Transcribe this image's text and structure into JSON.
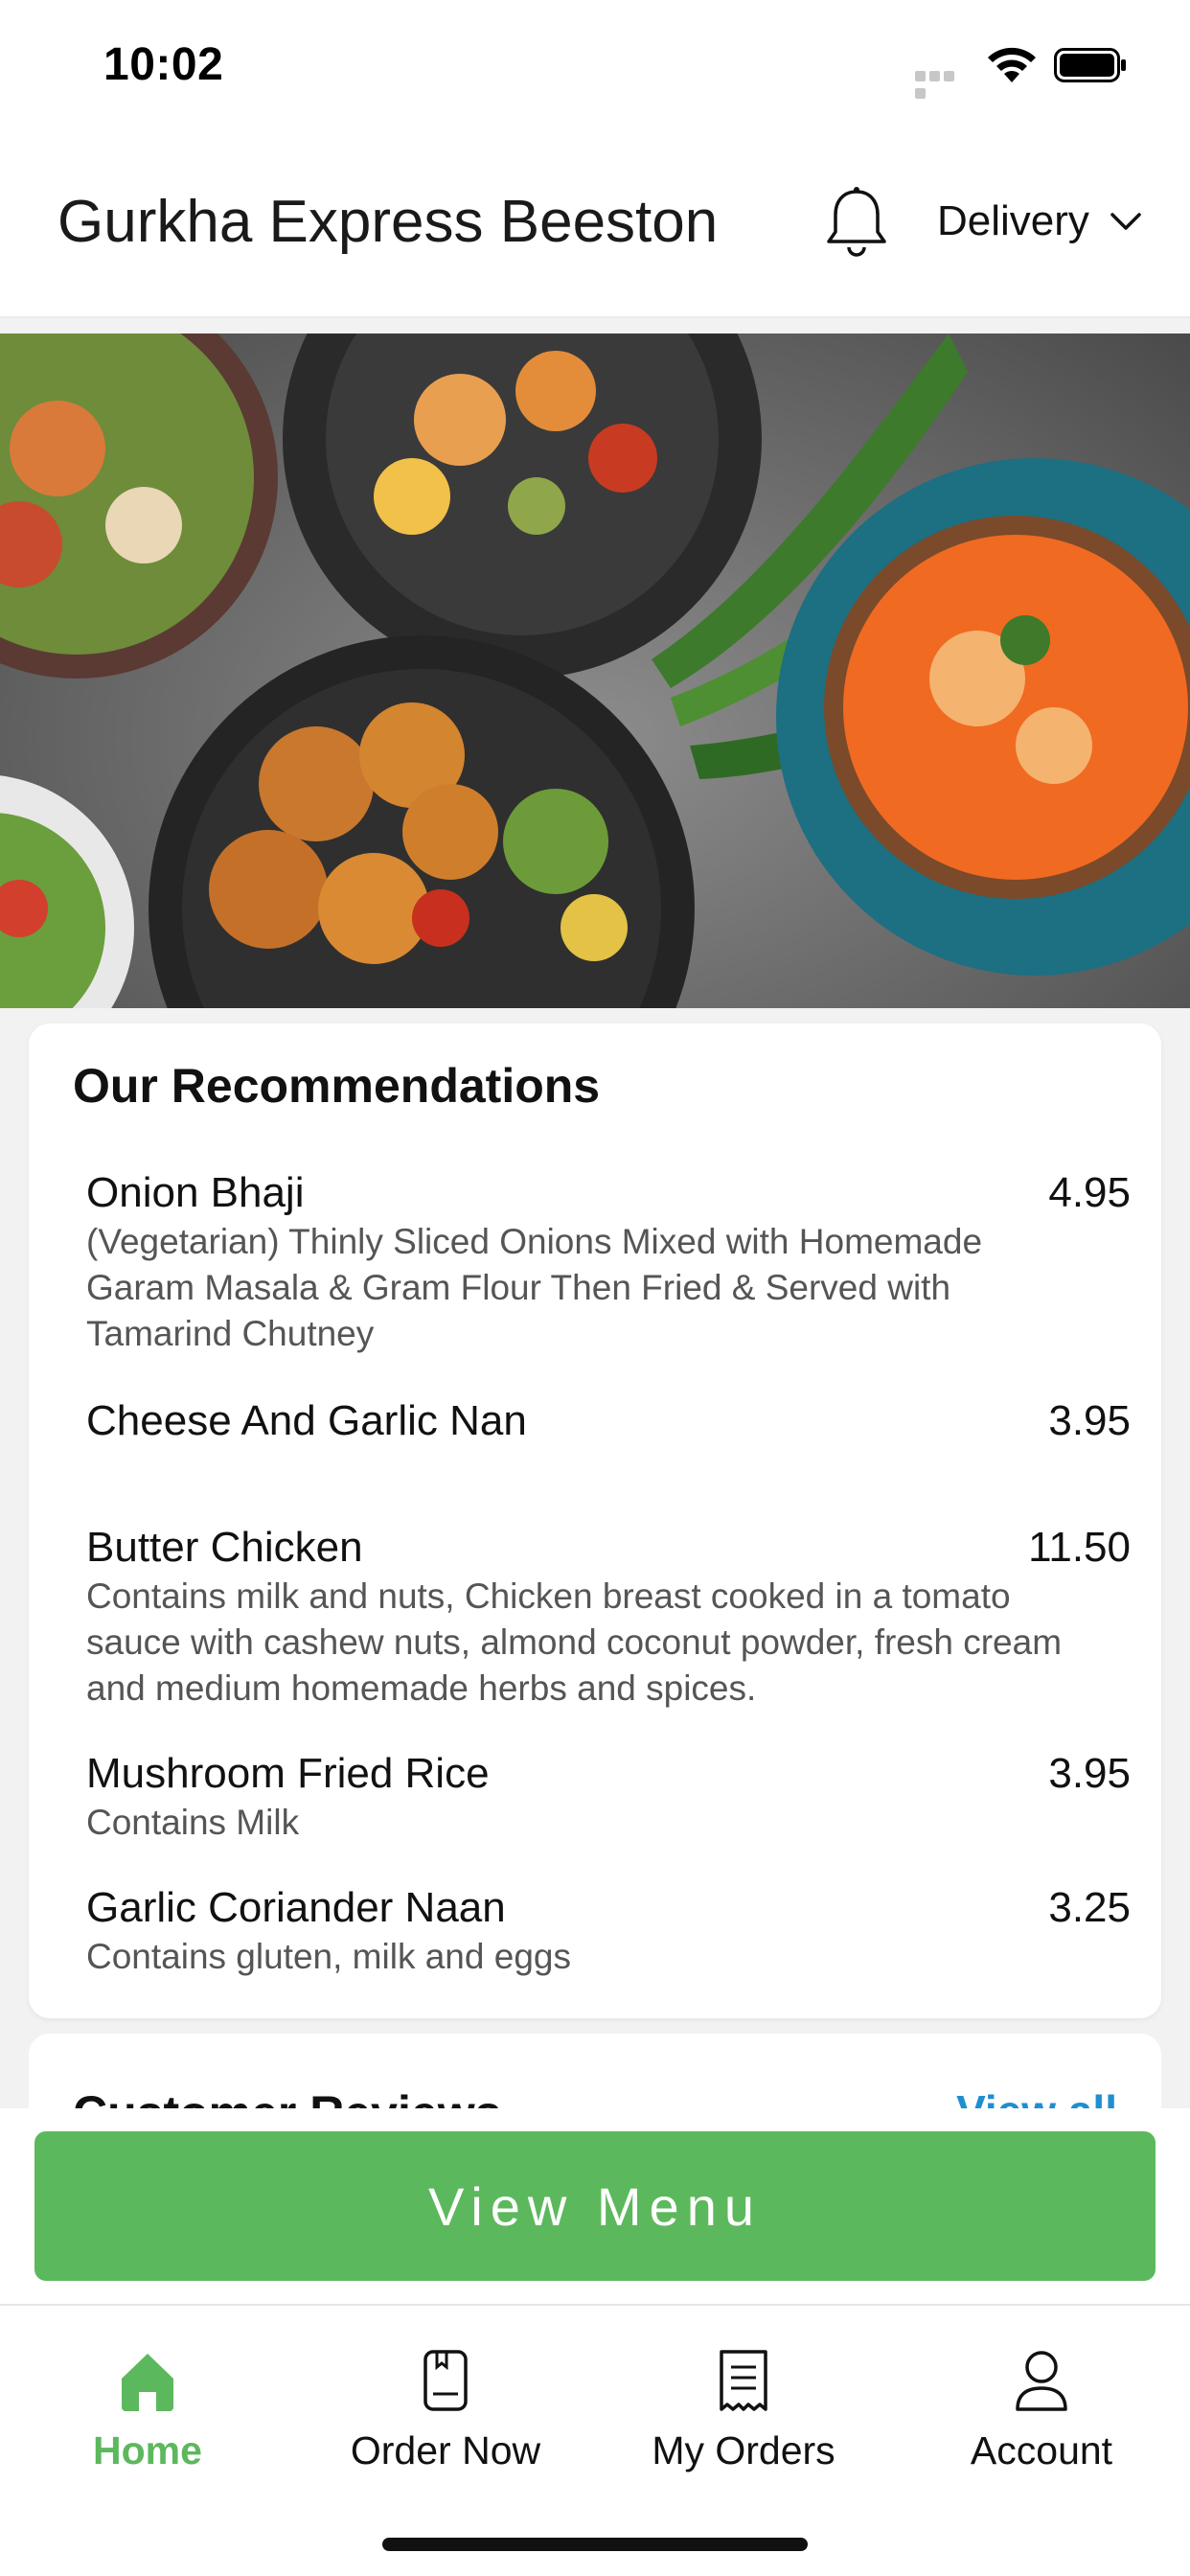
{
  "status_bar": {
    "time": "10:02"
  },
  "header": {
    "title": "Gurkha Express Beeston",
    "bell_icon": "bell-icon",
    "delivery_label": "Delivery",
    "chevron_icon": "chevron-down-icon"
  },
  "recommendations": {
    "title": "Our Recommendations",
    "items": [
      {
        "name": "Onion Bhaji",
        "price": "4.95",
        "desc_lines": [
          "(Vegetarian) Thinly Sliced Onions Mixed with Homemade",
          "Garam Masala & Gram Flour Then Fried & Served with",
          "Tamarind Chutney"
        ]
      },
      {
        "name": "Cheese And Garlic Nan",
        "price": "3.95",
        "desc_lines": []
      },
      {
        "name": "Butter Chicken",
        "price": "11.50",
        "desc_lines": [
          "Contains milk and nuts, Chicken breast cooked in a tomato",
          "sauce with cashew nuts, almond coconut powder, fresh cream",
          "and medium homemade herbs and spices."
        ]
      },
      {
        "name": "Mushroom Fried Rice",
        "price": "3.95",
        "desc_lines": [
          "Contains Milk"
        ]
      },
      {
        "name": "Garlic Coriander Naan",
        "price": "3.25",
        "desc_lines": [
          "Contains gluten, milk and eggs"
        ]
      }
    ]
  },
  "reviews": {
    "title": "Customer Reviews",
    "view_all": "View all"
  },
  "view_menu_button": "View Menu",
  "tabs": [
    {
      "label": "Home",
      "icon": "home-icon",
      "active": true
    },
    {
      "label": "Order Now",
      "icon": "order-now-icon",
      "active": false
    },
    {
      "label": "My Orders",
      "icon": "receipt-icon",
      "active": false
    },
    {
      "label": "Account",
      "icon": "account-icon",
      "active": false
    }
  ],
  "colors": {
    "accent": "#5cb85c",
    "link": "#1f8fd0"
  }
}
